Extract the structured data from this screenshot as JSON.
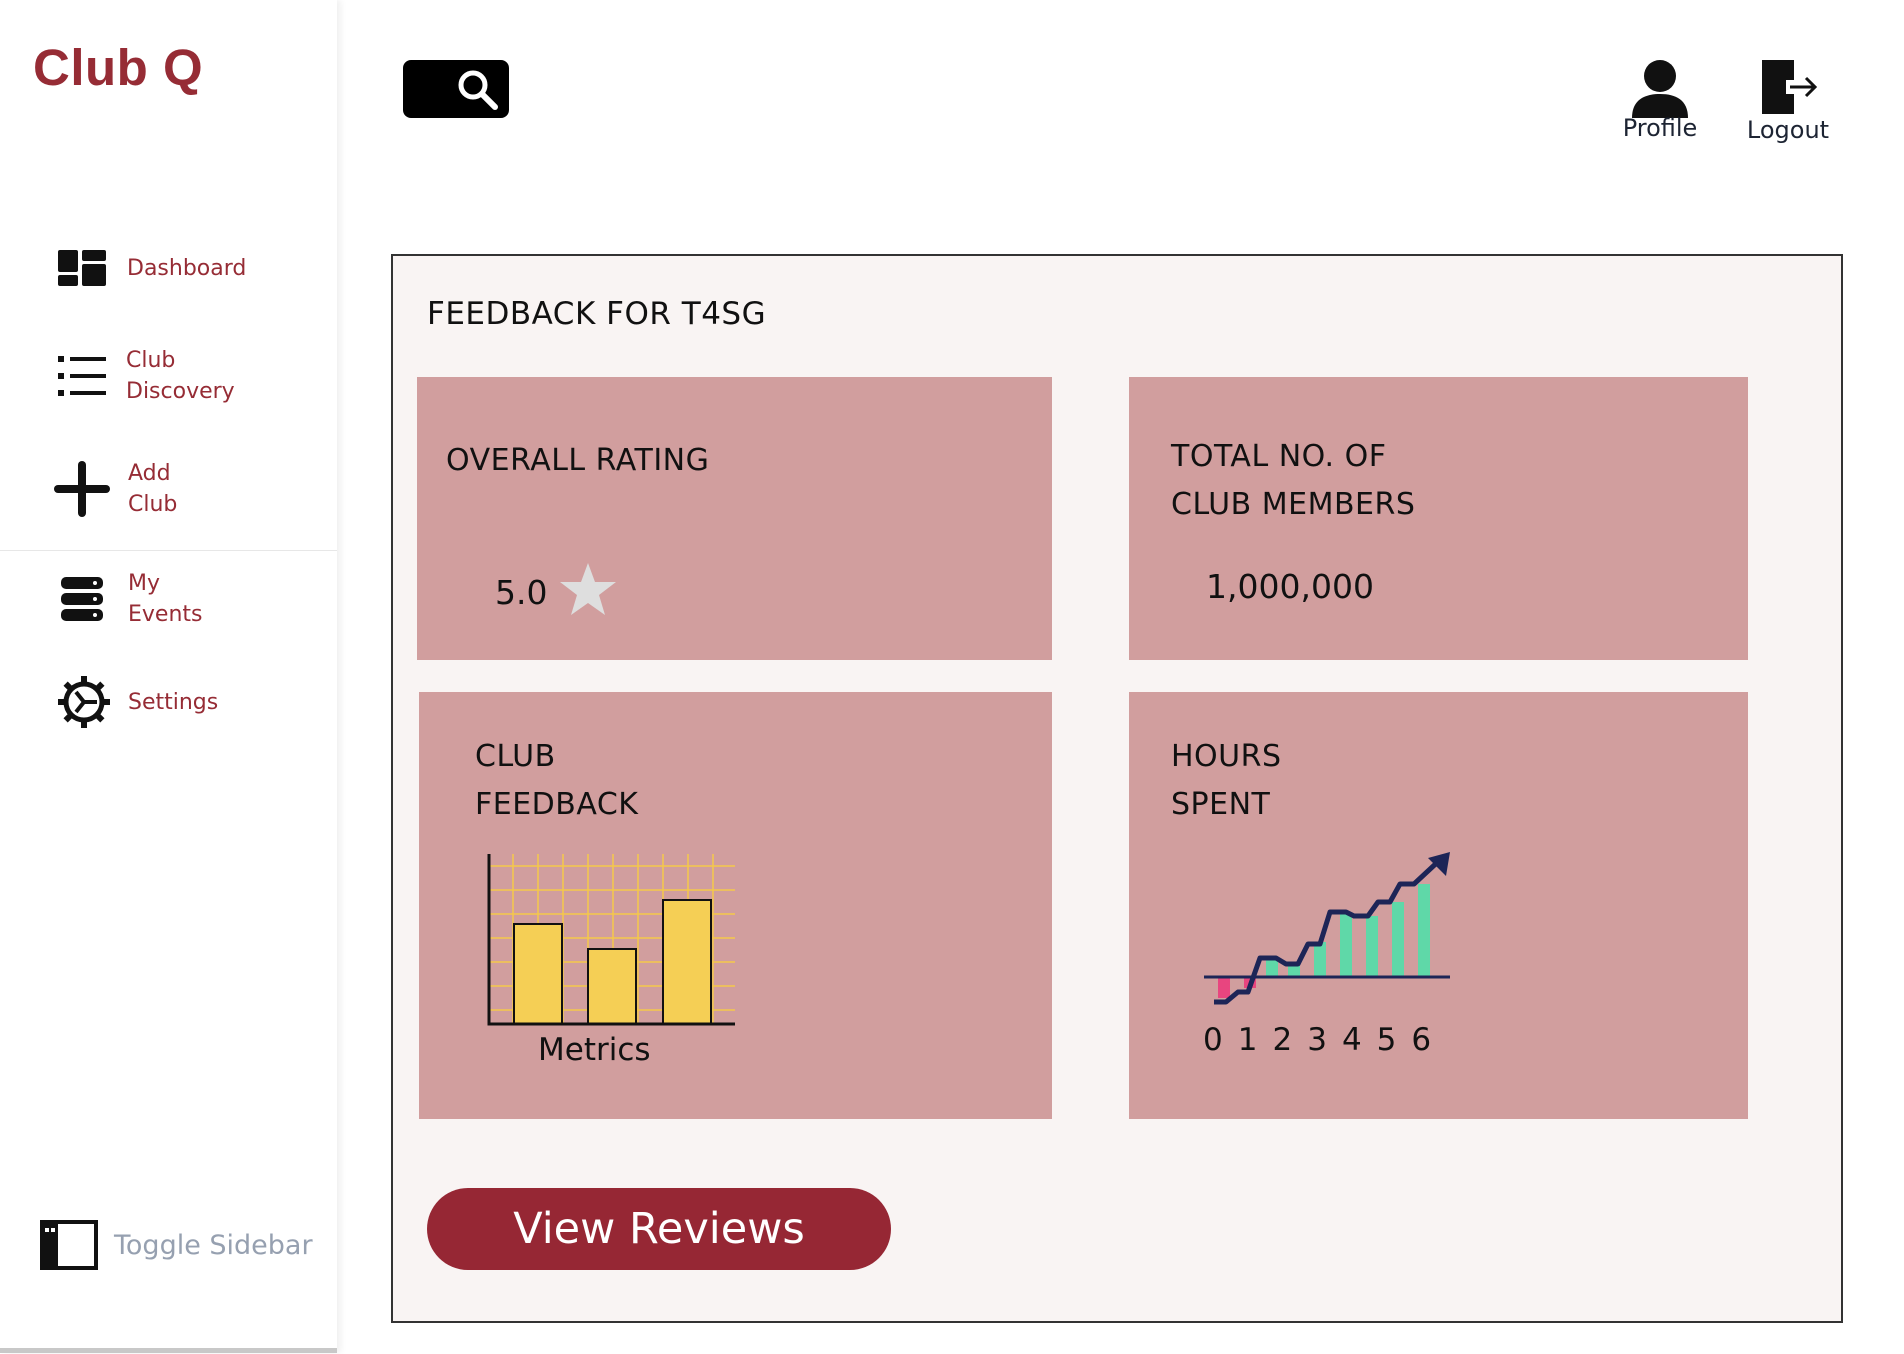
{
  "app": {
    "title": "Club Q"
  },
  "sidebar": {
    "items": [
      {
        "label": "Dashboard",
        "icon": "dashboard-icon"
      },
      {
        "label": "Club\nDiscovery",
        "icon": "list-icon"
      },
      {
        "label": "Add\nClub",
        "icon": "plus-icon"
      },
      {
        "label": "My\nEvents",
        "icon": "events-stack-icon"
      },
      {
        "label": "Settings",
        "icon": "gear-icon"
      }
    ],
    "toggle_label": "Toggle Sidebar"
  },
  "header": {
    "search_icon": "search-icon",
    "profile_label": "Profile",
    "logout_label": "Logout"
  },
  "main": {
    "title": "FEEDBACK FOR T4SG",
    "cards": {
      "rating": {
        "title": "OVERALL RATING",
        "value": "5.0",
        "icon": "star-icon"
      },
      "members": {
        "title": "TOTAL NO. OF\nCLUB MEMBERS",
        "value": "1,000,000"
      },
      "feedback": {
        "title": "CLUB\nFEEDBACK",
        "chart_label": "Metrics"
      },
      "hours": {
        "title": "HOURS\nSPENT",
        "axis_labels": [
          "0",
          "1",
          "2",
          "3",
          "4",
          "5",
          "6"
        ]
      }
    },
    "reviews_button": "View Reviews"
  },
  "colors": {
    "brand": "#962c35",
    "card": "#d19e9e",
    "panel": "#f9f4f3",
    "button": "#962734",
    "bar_yellow": "#f5cf55",
    "bar_green": "#5fd8a8",
    "bar_pink": "#e8457f",
    "trend_line": "#1d2557"
  }
}
